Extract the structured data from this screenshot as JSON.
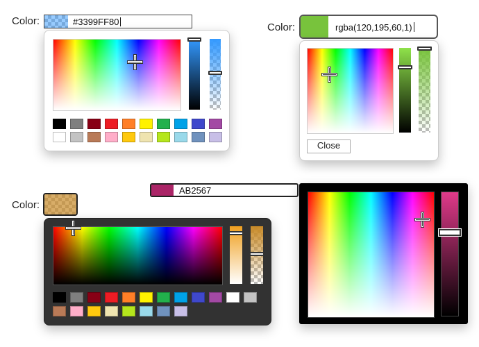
{
  "picker1": {
    "label": "Color:",
    "value": "#3399FF80",
    "swatch_color": "#3399FF",
    "swatch_alpha": 0.5,
    "palette_row1": [
      "#000000",
      "#7f7f7f",
      "#880015",
      "#ed1c24",
      "#ff7f27",
      "#fff200",
      "#22b14c",
      "#00a2e8",
      "#3f48cc",
      "#a349a4"
    ],
    "palette_row2": [
      "#ffffff",
      "#c3c3c3",
      "#b97a57",
      "#ffaec9",
      "#ffc90e",
      "#efe4b0",
      "#b5e61d",
      "#99d9ea",
      "#7092be",
      "#c8bfe7"
    ]
  },
  "picker2": {
    "label": "Color:",
    "value": "rgba(120,195,60,1)",
    "swatch_color": "#78C33C",
    "close_label": "Close"
  },
  "picker3": {
    "label": "Color:",
    "swatch_color": "#C88A28",
    "swatch_alpha": 0.7,
    "palette": [
      "#000000",
      "#7f7f7f",
      "#880015",
      "#ed1c24",
      "#ff7f27",
      "#fff200",
      "#22b14c",
      "#00a2e8",
      "#3f48cc",
      "#a349a4",
      "#ffffff",
      "#c3c3c3",
      "#b97a57",
      "#ffaec9",
      "#ffc90e",
      "#efe4b0",
      "#b5e61d",
      "#99d9ea",
      "#7092be",
      "#c8bfe7"
    ]
  },
  "picker4": {
    "value": "AB2567",
    "swatch_color": "#AB2567"
  }
}
